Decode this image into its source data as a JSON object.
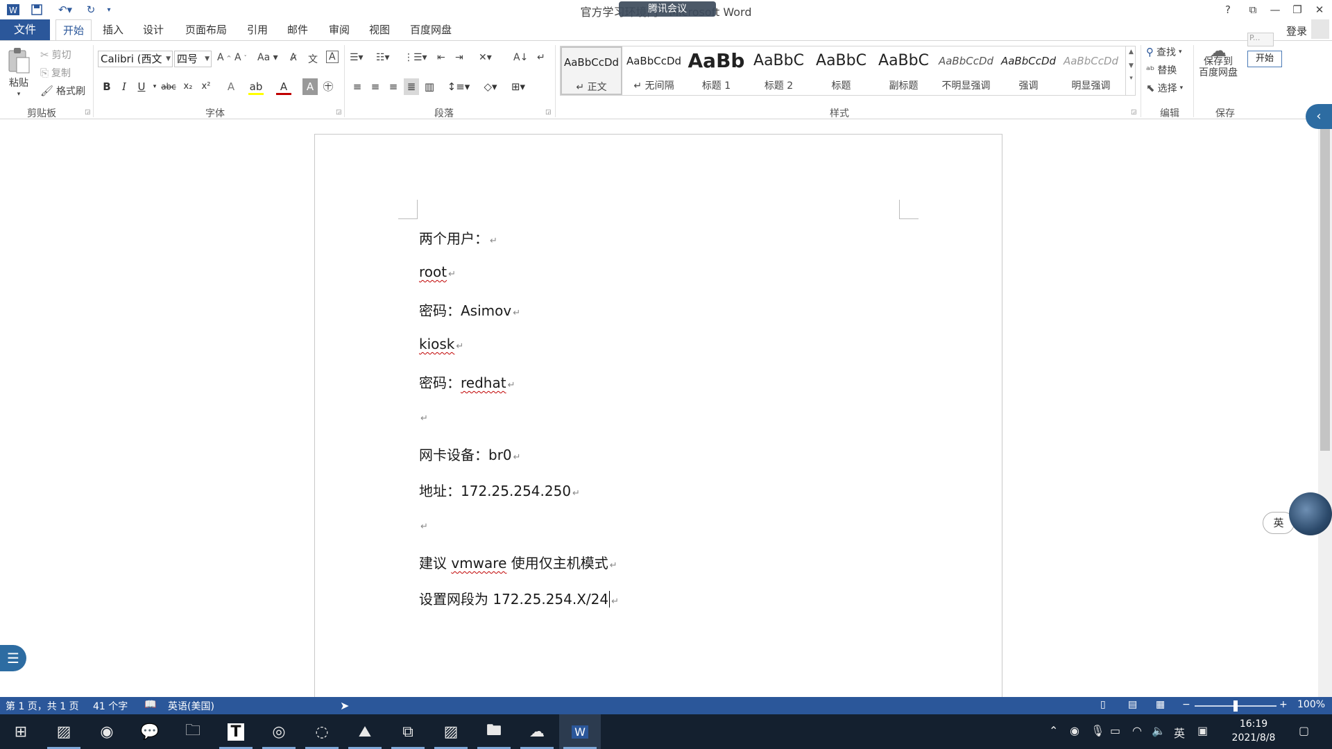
{
  "titlebar": {
    "title": "官方学习环境门 - Microsoft Word",
    "meeting_overlay": "腾讯会议",
    "help": "?",
    "window_buttons": [
      "ribbon-display",
      "minimize",
      "restore",
      "close"
    ]
  },
  "tabs": {
    "file": "文件",
    "items": [
      "开始",
      "插入",
      "设计",
      "页面布局",
      "引用",
      "邮件",
      "审阅",
      "视图",
      "百度网盘"
    ],
    "active": "开始",
    "login": "登录"
  },
  "clipboard": {
    "paste": "粘贴",
    "cut": "剪切",
    "copy": "复制",
    "format_painter": "格式刷",
    "label": "剪贴板"
  },
  "font": {
    "name": "Calibri (西文",
    "size": "四号",
    "label": "字体"
  },
  "paragraph": {
    "label": "段落"
  },
  "styles": {
    "label": "样式",
    "items": [
      {
        "sample": "AaBbCcDd",
        "name": "↵ 正文"
      },
      {
        "sample": "AaBbCcDd",
        "name": "↵ 无间隔"
      },
      {
        "sample": "AaBb",
        "name": "标题 1"
      },
      {
        "sample": "AaBbC",
        "name": "标题 2"
      },
      {
        "sample": "AaBbC",
        "name": "标题"
      },
      {
        "sample": "AaBbC",
        "name": "副标题"
      },
      {
        "sample": "AaBbCcDd",
        "name": "不明显强调"
      },
      {
        "sample": "AaBbCcDd",
        "name": "强调"
      },
      {
        "sample": "AaBbCcDd",
        "name": "明显强调"
      }
    ]
  },
  "editing": {
    "find": "查找",
    "replace": "替换",
    "select": "选择",
    "label": "编辑"
  },
  "save": {
    "save_to_baidu_line1": "保存到",
    "save_to_baidu_line2": "百度网盘",
    "label": "保存",
    "start": "开始",
    "mini_box": "P..."
  },
  "document": {
    "paragraphs": [
      {
        "cn": "两个用户：",
        "en": ""
      },
      {
        "cn": "",
        "en": "root"
      },
      {
        "cn": "密码：",
        "en": "Asimov"
      },
      {
        "cn": "",
        "en": "kiosk"
      },
      {
        "cn": "密码：",
        "en": "redhat"
      },
      {
        "cn": "",
        "en": ""
      },
      {
        "cn": "网卡设备：",
        "en": "br0"
      },
      {
        "cn": "地址：",
        "en": "172.25.254.250"
      },
      {
        "cn": "",
        "en": ""
      },
      {
        "cn": "建议 ",
        "en": "vmware",
        "cn2": " 使用仅主机模式"
      },
      {
        "cn": "设置网段为 ",
        "en": "172.25.254.X/24"
      }
    ],
    "para_mark": "↵"
  },
  "ime": {
    "badge": "英"
  },
  "status": {
    "page": "第 1 页，共 1 页",
    "words": "41 个字",
    "language": "英语(美国)",
    "zoom": "100%",
    "zoom_minus": "−",
    "zoom_plus": "+"
  },
  "taskbar": {
    "apps": [
      "start",
      "figure-app",
      "chrome",
      "wechat",
      "file-explorer",
      "typora",
      "netease-music",
      "browser-swirl",
      "cloud-app",
      "vm-app",
      "figure-app-2",
      "photos",
      "baidu-netdisk",
      "word"
    ],
    "tray_lang": "英",
    "time": "16:19",
    "date": "2021/8/8"
  }
}
